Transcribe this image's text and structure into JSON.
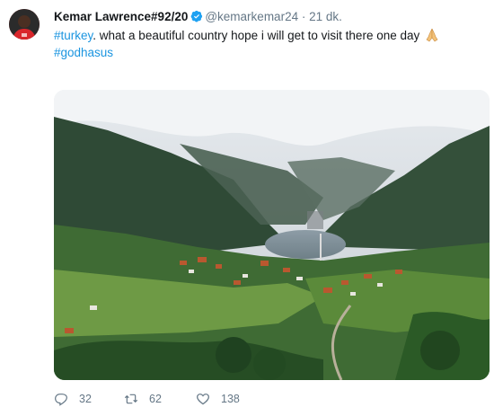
{
  "tweet": {
    "author_name": "Kemar Lawrence#92/20",
    "handle": "@kemarkemar24",
    "separator": "·",
    "time": "21 dk.",
    "hashtag1": "#turkey",
    "text_body": ". what a beautiful country hope i will get to visit there one day ",
    "hashtag2": "#godhasus"
  },
  "actions": {
    "replies": "32",
    "retweets": "62",
    "likes": "138"
  },
  "icons": {
    "avatar": "profile-photo",
    "verified": "verified-badge-icon",
    "emoji": "folded-hands-emoji",
    "reply": "reply-icon",
    "retweet": "retweet-icon",
    "like": "heart-icon"
  },
  "colors": {
    "link": "#1b95e0",
    "verified": "#1da1f2",
    "muted": "#657786"
  }
}
